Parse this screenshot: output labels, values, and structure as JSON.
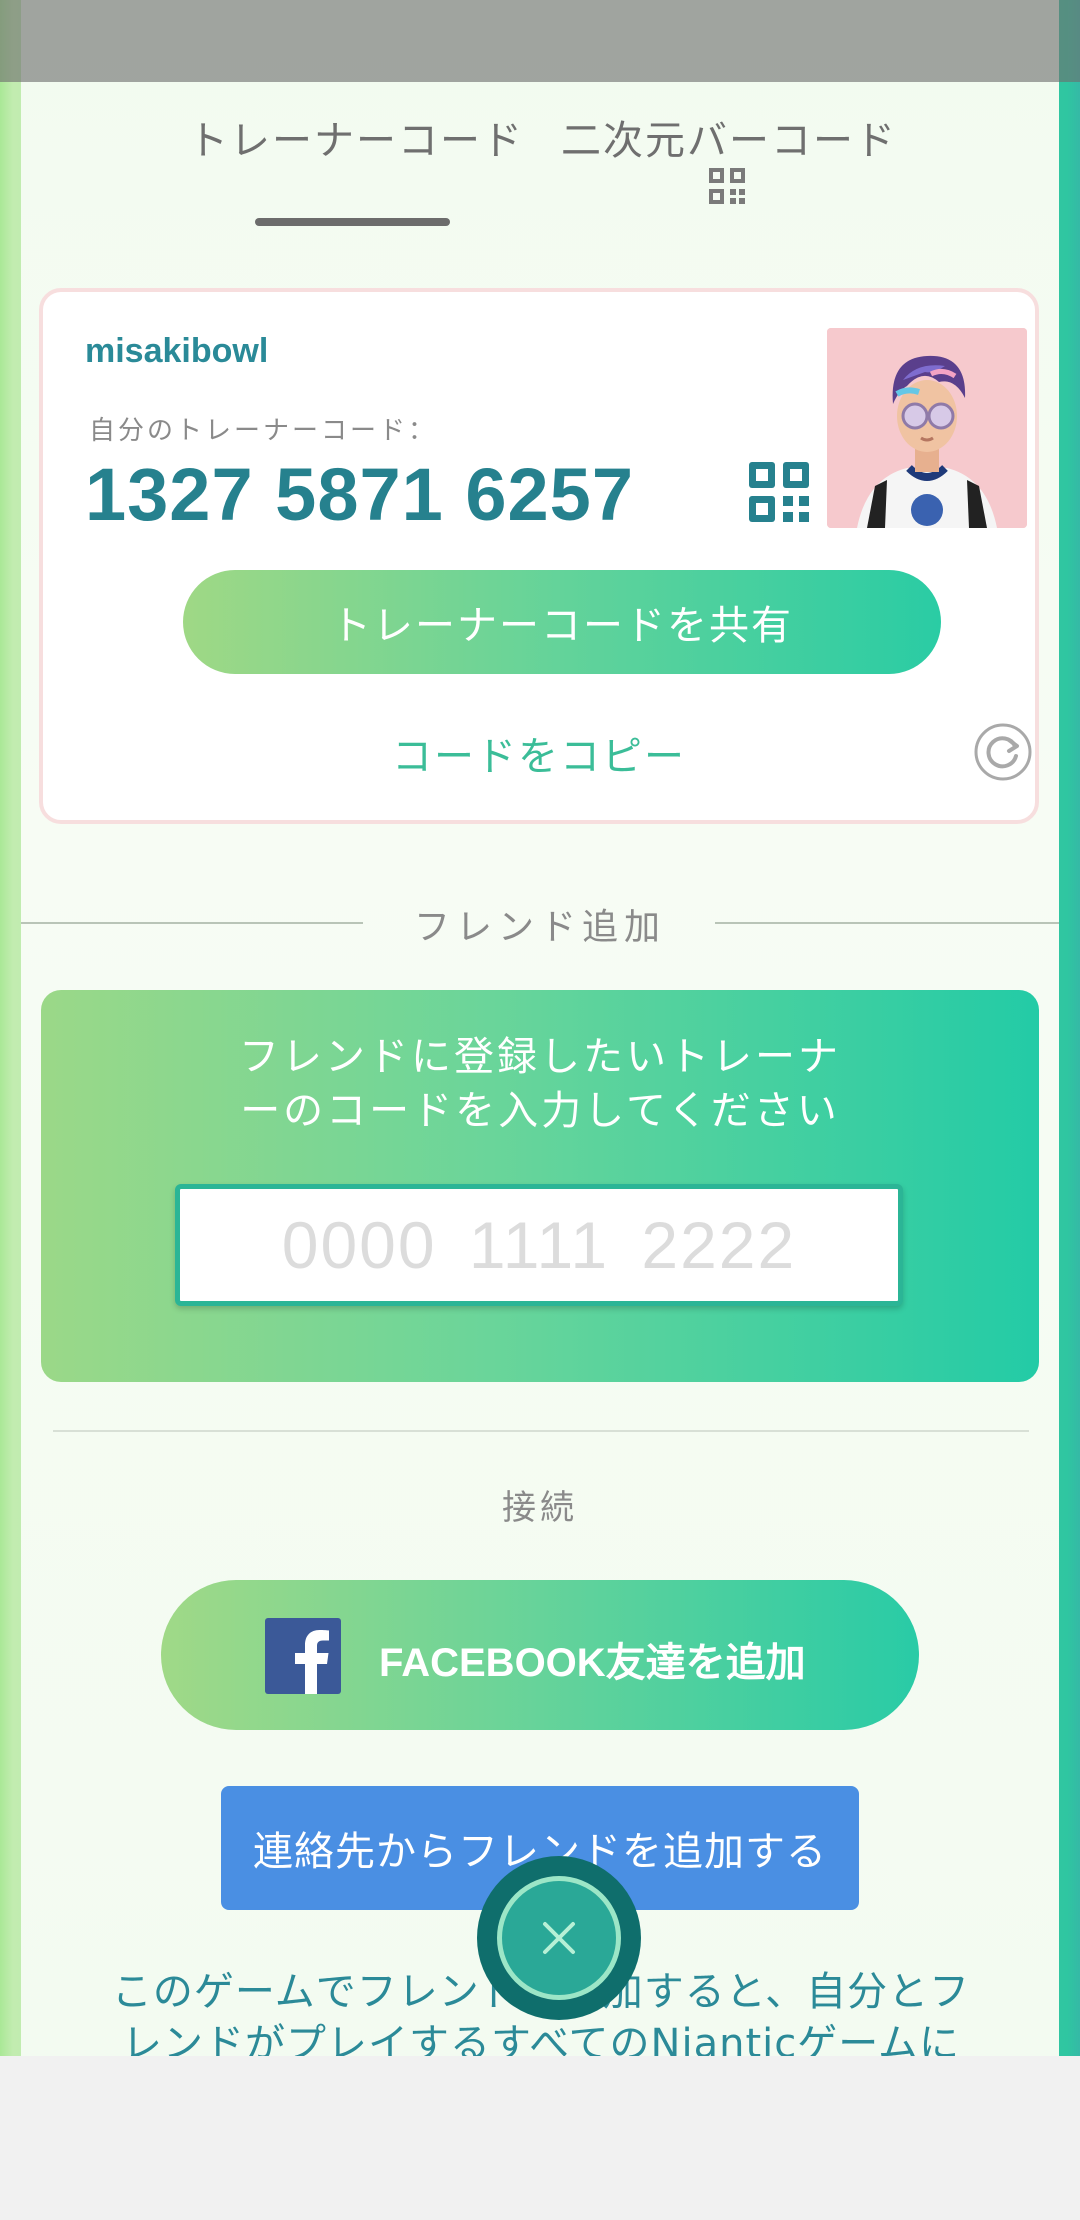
{
  "tabs": [
    {
      "label": "トレーナーコード",
      "active": true
    },
    {
      "label": "二次元バーコード",
      "icon": "qr-code-icon"
    }
  ],
  "card": {
    "username": "misakibowl",
    "code_label": "自分のトレーナーコード：",
    "code_value": "1327 5871 6257",
    "share_button": "トレーナーコードを共有",
    "copy_link": "コードをコピー"
  },
  "friend_add": {
    "section_title": "フレンド追加",
    "instruction_line1": "フレンドに登録したいトレーナ",
    "instruction_line2": "ーのコードを入力してください",
    "input_placeholder": "0000 1111 2222",
    "input_value": ""
  },
  "connect": {
    "section_title": "接続",
    "facebook_button": "FACEBOOK友達を追加",
    "contacts_button": "連絡先からフレンドを追加する"
  },
  "footer": {
    "line1": "このゲームでフレンドを追加すると、自分とフ",
    "line2": "レンドがプレイするすべてのNianticゲームに"
  },
  "colors": {
    "accent_teal": "#26818e",
    "green_start": "#9fd885",
    "green_end": "#2acca4",
    "contacts_blue": "#4a8fe3",
    "close_fab": "#0f6e6c"
  }
}
